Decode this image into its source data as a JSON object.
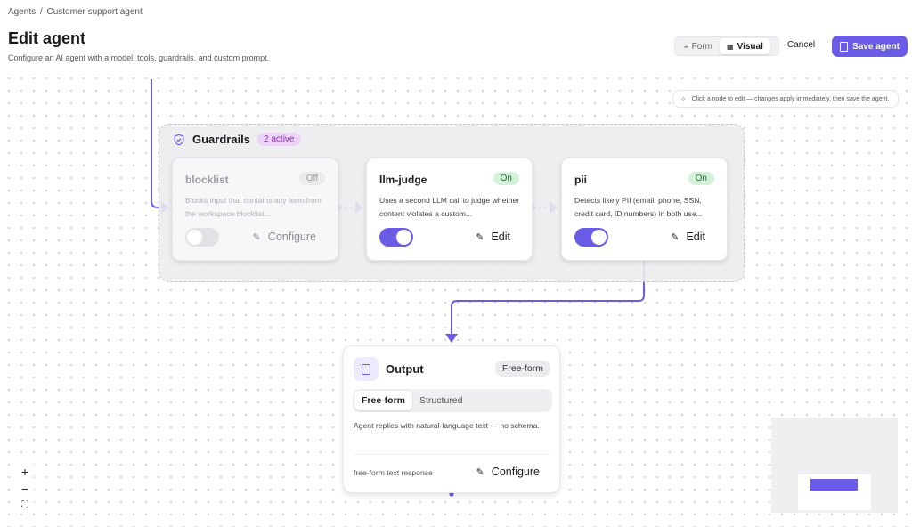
{
  "breadcrumb": {
    "root": "Agents",
    "sep": "/",
    "current": "Customer support agent"
  },
  "page": {
    "title": "Edit agent",
    "subtitle": "Configure an AI agent with a model, tools, guardrails, and custom prompt."
  },
  "view_toggle": {
    "form_label": "Form",
    "visual_label": "Visual",
    "active": "Visual"
  },
  "actions": {
    "cancel_label": "Cancel",
    "save_label": "Save agent"
  },
  "hint": {
    "text": "Click a node to edit — changes apply immediately, then save the agent."
  },
  "guardrails": {
    "title": "Guardrails",
    "badge": "2 active",
    "nodes": [
      {
        "name": "blocklist",
        "status": "Off",
        "enabled": false,
        "description": "Blocks input that contains any term from the workspace blocklist...",
        "action": "Configure"
      },
      {
        "name": "llm-judge",
        "status": "On",
        "enabled": true,
        "description": "Uses a second LLM call to judge whether content violates a custom...",
        "action": "Edit"
      },
      {
        "name": "pii",
        "status": "On",
        "enabled": true,
        "description": "Detects likely PII (email, phone, SSN, credit card, ID numbers) in both use...",
        "action": "Edit"
      }
    ]
  },
  "output": {
    "title": "Output",
    "badge": "Free-form",
    "tabs": [
      "Free-form",
      "Structured"
    ],
    "active_tab": "Free-form",
    "description": "Agent replies with natural-language text — no schema.",
    "footer": "free-form text response",
    "action": "Configure"
  },
  "zoom": {
    "in": "+",
    "out": "−",
    "fit": "⛶"
  },
  "colors": {
    "accent": "#6b5ce7",
    "on_bg": "#d3f0d8",
    "badge_bg": "#ecd3f7"
  }
}
